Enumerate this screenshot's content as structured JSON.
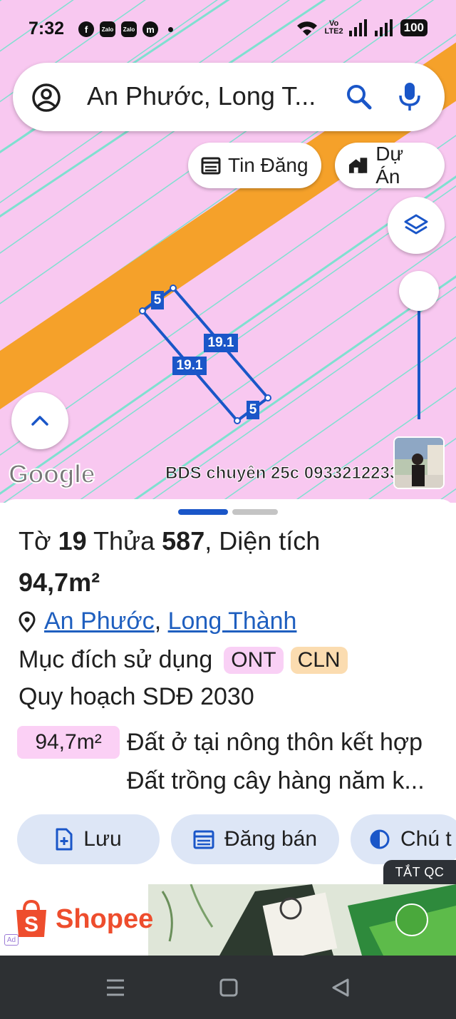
{
  "status_bar": {
    "time": "7:32",
    "app_icons": [
      "f",
      "Zalo",
      "Zalo",
      "m"
    ],
    "network_label_1": "Vo",
    "network_label_2": "LTE2",
    "battery": "100"
  },
  "search": {
    "value": "An Phước, Long T..."
  },
  "chips": {
    "listings": "Tin Đăng",
    "projects": "Dự Án"
  },
  "map": {
    "parcel_labels": {
      "short_top": "5",
      "long_right": "19.1",
      "long_left": "19.1",
      "short_bottom": "5"
    },
    "google_logo": "Google",
    "watermark": "BDS chuyên 25c 0933212233"
  },
  "details": {
    "title_line1_prefix": "Tờ ",
    "sheet_no": "19",
    "title_line1_mid": " Thửa ",
    "parcel_no": "587",
    "title_line1_suffix": ", Diện tích",
    "area": "94,7m²",
    "location_ward": "An Phước",
    "location_sep": ",",
    "location_district": "Long Thành",
    "purpose_label": "Mục đích sử dụng",
    "purpose_tags": [
      "ONT",
      "CLN"
    ],
    "plan_title": "Quy hoạch SDĐ 2030",
    "plan_area": "94,7m²",
    "plan_use_1": "Đất ở tại nông thôn kết hợp",
    "plan_use_2": "Đất trồng cây hàng năm k..."
  },
  "actions": {
    "save": "Lưu",
    "post_sale": "Đăng bán",
    "note": "Chú t"
  },
  "ads": {
    "toggle": "TẮT QC",
    "brand": "Shopee",
    "ad_badge": "Ad"
  },
  "colors": {
    "map_pink": "#f8c8f0",
    "parcel_line": "#7fe0d0",
    "road": "#f5a12a",
    "accent_blue": "#1a56c8",
    "tag_ont": "#f9d0f5",
    "tag_cln": "#fbdcb0",
    "button_bg": "#dde6f6"
  }
}
